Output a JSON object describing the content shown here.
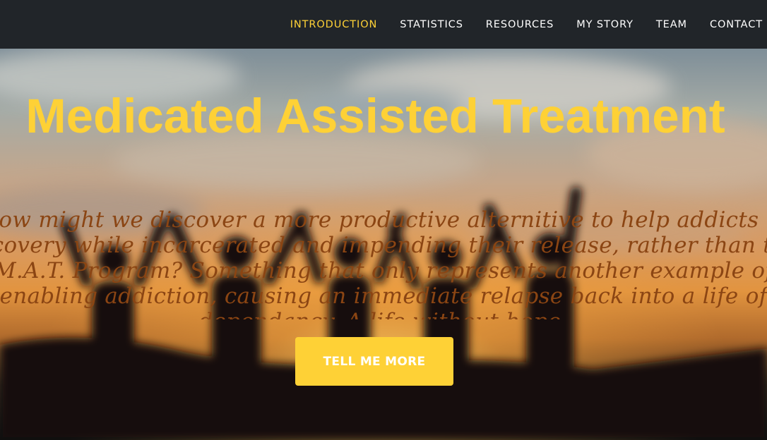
{
  "nav": {
    "items": [
      {
        "label": "INTRODUCTION",
        "active": true
      },
      {
        "label": "STATISTICS",
        "active": false
      },
      {
        "label": "RESOURCES",
        "active": false
      },
      {
        "label": "MY STORY",
        "active": false
      },
      {
        "label": "TEAM",
        "active": false
      },
      {
        "label": "CONTACT",
        "active": false
      }
    ]
  },
  "hero": {
    "title": "Medicated Assisted Treatment",
    "lead": "How might we discover a more productive alternitive to help addicts in recovery while incarcerated and impending their release, rather than the M.A.T. Program? Something that only represents another example of enabling addiction, causing an immediate relapse back into a life of dependancy. A life without hope.",
    "cta_label": "TELL ME MORE",
    "background": "silhouettes of people with raised arms against a sunset sky"
  },
  "colors": {
    "accent": "#fed136",
    "navbar": "#212529",
    "lead_text": "#8b4513",
    "nav_text": "#ffffff"
  }
}
